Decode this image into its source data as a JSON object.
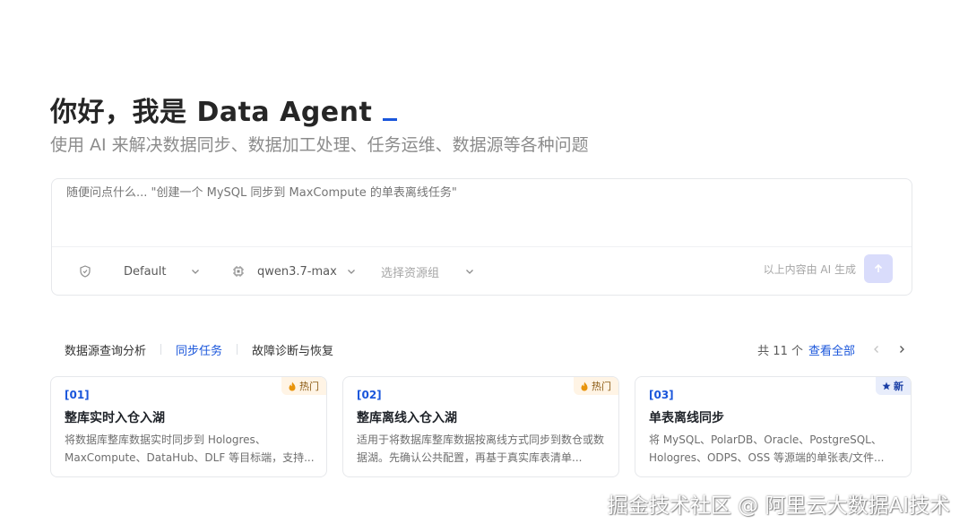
{
  "hero": {
    "greeting": "你好，我是 Data Agent",
    "subtitle": "使用 AI 来解决数据同步、数据加工处理、任务运维、数据源等各种问题"
  },
  "composer": {
    "placeholder": "随便问点什么... \"创建一个 MySQL 同步到 MaxCompute 的单表离线任务\"",
    "mode_icon": "shield-icon",
    "mode_label": "Default",
    "model_icon": "chip-icon",
    "model_label": "qwen3.7-max",
    "resource_group_placeholder": "选择资源组",
    "ai_note": "以上内容由 AI 生成",
    "send_icon": "arrow-up-icon"
  },
  "tabs": [
    {
      "label": "数据源查询分析",
      "active": false
    },
    {
      "label": "同步任务",
      "active": true
    },
    {
      "label": "故障诊断与恢复",
      "active": false
    }
  ],
  "list_header": {
    "count_text": "共 11 个",
    "view_all": "查看全部"
  },
  "cards": [
    {
      "index": "[01]",
      "title": "整库实时入仓入湖",
      "description": "将数据库整库数据实时同步到 Hologres、MaxCompute、DataHub、DLF 等目标端，支持...",
      "badge": "热门",
      "badge_icon": "fire-icon"
    },
    {
      "index": "[02]",
      "title": "整库离线入仓入湖",
      "description": "适用于将数据库整库数据按离线方式同步到数仓或数据湖。先确认公共配置，再基于真实库表清单...",
      "badge": "热门",
      "badge_icon": "fire-icon"
    },
    {
      "index": "[03]",
      "title": "单表离线同步",
      "description": "将 MySQL、PolarDB、Oracle、PostgreSQL、Hologres、ODPS、OSS 等源端的单张表/文件...",
      "badge": "新",
      "badge_icon": "star-icon"
    }
  ],
  "watermark": "掘金技术社区 @ 阿里云大数据AI技术",
  "colors": {
    "accent": "#1a56db",
    "send_button": "#d9dcfb",
    "hot_badge_bg": "#fff4e5",
    "new_badge_bg": "#e8edfb"
  }
}
